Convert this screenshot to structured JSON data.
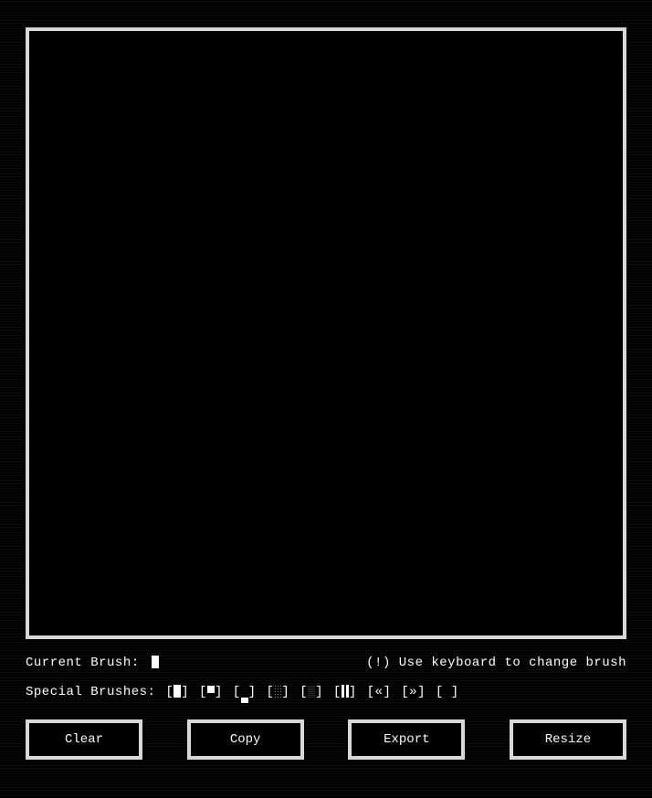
{
  "canvas": {
    "border_color": "#d8d8d8"
  },
  "brush": {
    "label": "Current Brush:",
    "current": "█",
    "hint": "(!) Use keyboard to change brush"
  },
  "special_brushes": {
    "label": "Special Brushes:",
    "options": [
      {
        "glyph": "█",
        "class": "g-full"
      },
      {
        "glyph": "▀",
        "class": "g-upper"
      },
      {
        "glyph": "▄",
        "class": "g-lower"
      },
      {
        "glyph": "░",
        "class": "g-light"
      },
      {
        "glyph": " ",
        "class": "g-medium"
      },
      {
        "glyph": "▌",
        "class": "g-vbar"
      },
      {
        "glyph": "«",
        "class": ""
      },
      {
        "glyph": "»",
        "class": ""
      },
      {
        "glyph": " ",
        "class": "g-space"
      }
    ]
  },
  "buttons": {
    "clear": "Clear",
    "copy": "Copy",
    "export": "Export",
    "resize": "Resize"
  }
}
